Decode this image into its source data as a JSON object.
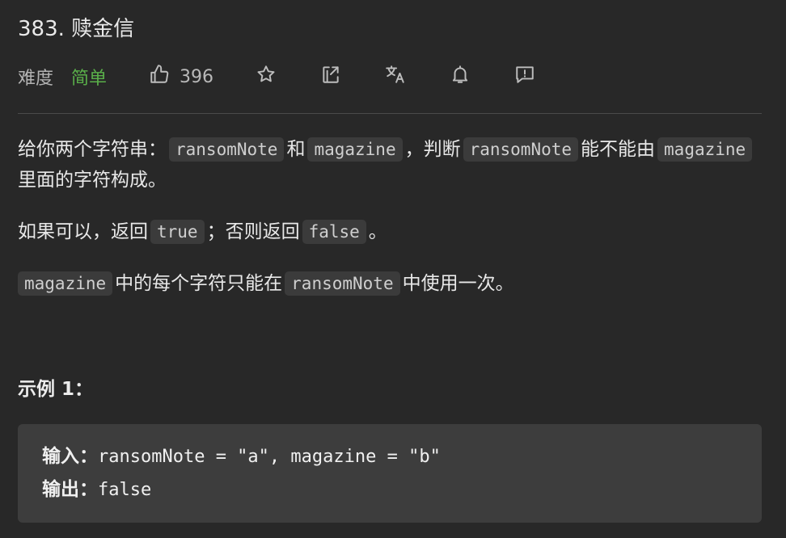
{
  "problem": {
    "title": "383. 赎金信"
  },
  "meta": {
    "difficulty_label": "难度",
    "difficulty_value": "简单",
    "likes": "396",
    "icons": [
      "thumbs-up-icon",
      "star-icon",
      "share-icon",
      "translate-icon",
      "bell-icon",
      "feedback-icon"
    ],
    "difficulty_color": "#5ab04a"
  },
  "description": {
    "p1": {
      "t1": "给你两个字符串：",
      "c1": "ransomNote",
      "t2": "和",
      "c2": "magazine",
      "t3": "，判断",
      "c3": "ransomNote",
      "t4": "能不能由",
      "c4": "magazine",
      "t5": "里面的字符构成。"
    },
    "p2": {
      "t1": "如果可以，返回",
      "c1": "true",
      "t2": "；否则返回",
      "c2": "false",
      "t3": "。"
    },
    "p3": {
      "c1": "magazine",
      "t1": "中的每个字符只能在",
      "c2": "ransomNote",
      "t2": "中使用一次。"
    }
  },
  "example": {
    "title": "示例 1：",
    "input_label": "输入：",
    "input_value": "ransomNote = \"a\", magazine = \"b\"",
    "output_label": "输出：",
    "output_value": "false"
  }
}
